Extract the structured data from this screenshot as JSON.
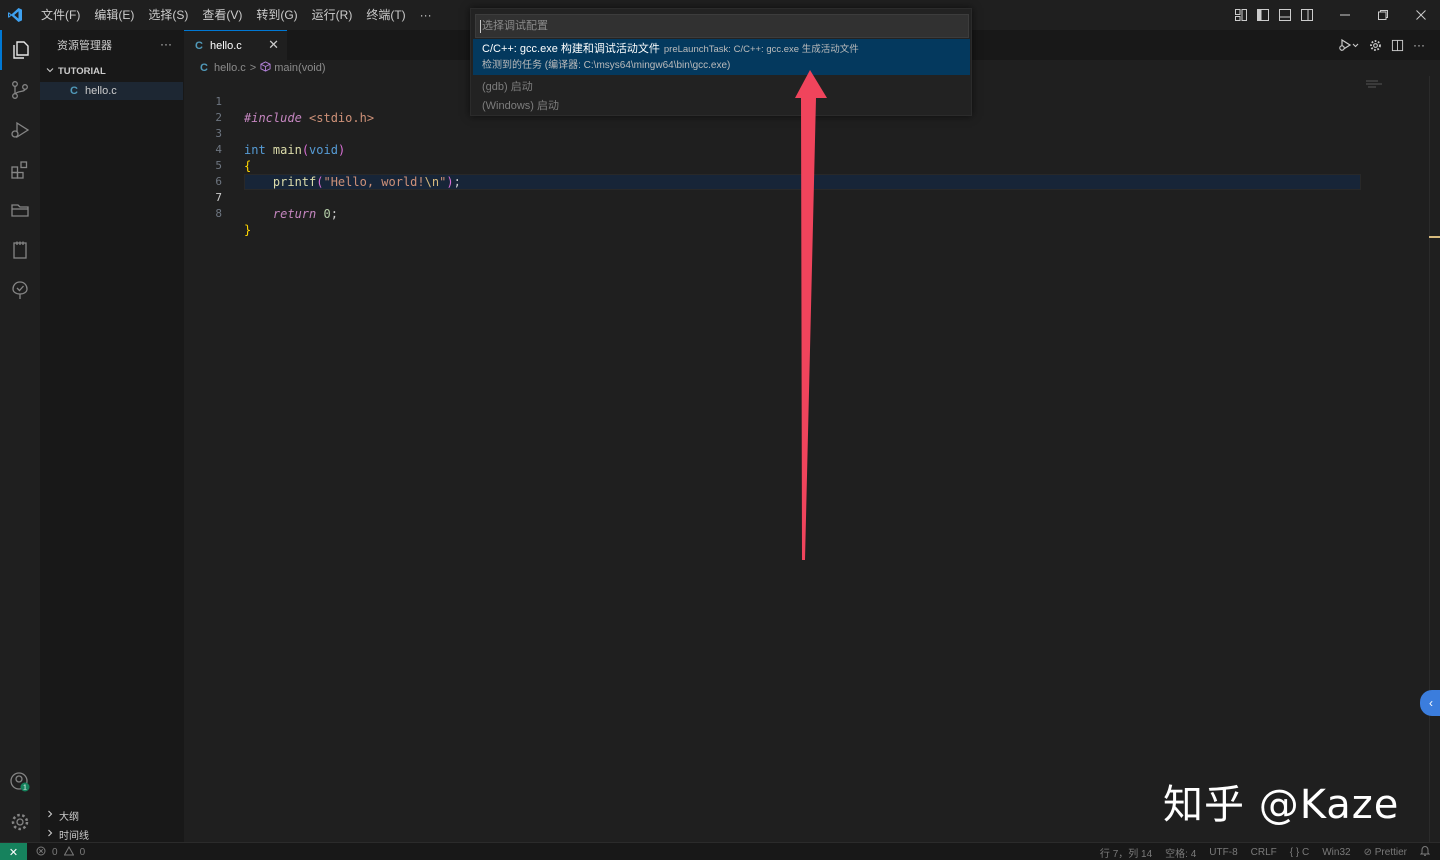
{
  "menu": [
    "文件(F)",
    "编辑(E)",
    "选择(S)",
    "查看(V)",
    "转到(G)",
    "运行(R)",
    "终端(T)",
    "···"
  ],
  "sidebar": {
    "title": "资源管理器",
    "more": "···",
    "folder": "TUTORIAL",
    "files": [
      "hello.c"
    ],
    "outline": "大纲",
    "timeline": "时间线"
  },
  "tab": {
    "label": "hello.c",
    "close": "✕"
  },
  "breadcrumb": {
    "file": "hello.c",
    "symbol": "main(void)",
    "sep": ">"
  },
  "code": {
    "line_numbers": [
      "1",
      "2",
      "3",
      "4",
      "5",
      "6",
      "7",
      "8"
    ],
    "l1_directive": "#include",
    "l1_header": " <stdio.h>",
    "l3_type": "int",
    "l3_fn": " main",
    "l3_open": "(",
    "l3_arg": "void",
    "l3_close": ")",
    "l4": "{",
    "l5_fn": "    printf",
    "l5_open": "(",
    "l5_str1": "\"Hello, world!",
    "l5_esc": "\\n",
    "l5_str2": "\"",
    "l5_close": ")",
    "l5_semi": ";",
    "l7_kw": "    return",
    "l7_num": " 0",
    "l7_semi": ";",
    "l8": "}"
  },
  "quickpick": {
    "placeholder": "选择调试配置",
    "selected_label": "C/C++: gcc.exe 构建和调试活动文件",
    "selected_desc": "preLaunchTask: C/C++: gcc.exe 生成活动文件",
    "selected_detail": "检测到的任务 (编译器: C:\\msys64\\mingw64\\bin\\gcc.exe)",
    "items": [
      "(gdb) 启动",
      "(Windows) 启动"
    ]
  },
  "statusbar": {
    "remote": "✕",
    "errors": "0",
    "warnings": "0",
    "position": "行 7，列 14",
    "spaces": "空格: 4",
    "encoding": "UTF-8",
    "eol": "CRLF",
    "language": "{ } C",
    "platform": "Win32",
    "prettier": "Prettier"
  },
  "watermark": "知乎 @Kaze",
  "colors": {
    "accent": "#0078d4",
    "arrow": "#f0445c",
    "selection": "#04395e",
    "remote": "#16825d"
  }
}
